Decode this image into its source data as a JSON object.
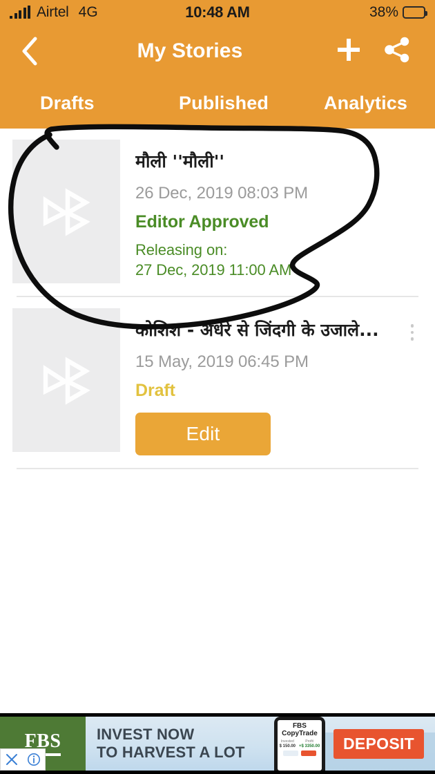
{
  "statusbar": {
    "carrier": "Airtel",
    "network": "4G",
    "time": "10:48 AM",
    "battery_pct": "38%",
    "battery_level": 38,
    "signal_icon": "signal-bars-icon",
    "battery_icon": "battery-icon"
  },
  "navbar": {
    "back_icon": "back-chevron-icon",
    "title": "My Stories",
    "add_icon": "plus-icon",
    "share_icon": "share-icon"
  },
  "tabs": [
    {
      "label": "Drafts",
      "name": "tab-drafts",
      "active": true
    },
    {
      "label": "Published",
      "name": "tab-published",
      "active": false
    },
    {
      "label": "Analytics",
      "name": "tab-analytics",
      "active": false
    }
  ],
  "stories": [
    {
      "title": "मौली ''मौली''",
      "date": "26 Dec, 2019 08:03 PM",
      "status": "Editor Approved",
      "status_type": "approved",
      "release_label": "Releasing on:",
      "release_date": "27 Dec, 2019 11:00 AM",
      "thumb_icon": "matrubharti-logo-icon",
      "menu_icon": "kebab-menu-icon"
    },
    {
      "title": "कोशिश - अंधेरे से जिंदगी के उजाले...",
      "date": "15 May, 2019 06:45 PM",
      "status": "Draft",
      "status_type": "draft",
      "action_label": "Edit",
      "thumb_icon": "matrubharti-logo-icon",
      "menu_icon": "kebab-menu-icon"
    }
  ],
  "ad": {
    "brand": "FBS",
    "headline_line1": "INVEST NOW",
    "headline_line2": "TO HARVEST A LOT",
    "phone_title_line1": "FBS",
    "phone_title_line2": "CopyTrade",
    "phone_stat1_label": "Invested",
    "phone_stat1_value": "$ 150.00",
    "phone_stat2_label": "Profit",
    "phone_stat2_value": "+$ 3350.00",
    "cta": "DEPOSIT",
    "close_icon": "close-x-icon",
    "info_icon": "ad-info-icon"
  },
  "annotation": {
    "type": "hand-drawn-circle",
    "color": "#0d0d0d",
    "description": "handwritten black oval circling the first story item"
  },
  "colors": {
    "brand_orange": "#e89a33",
    "button_orange": "#eaa637",
    "approved_green": "#4a8c26",
    "draft_yellow": "#e2c23f",
    "thumb_gray": "#ececed",
    "date_gray": "#9b9b9b"
  }
}
